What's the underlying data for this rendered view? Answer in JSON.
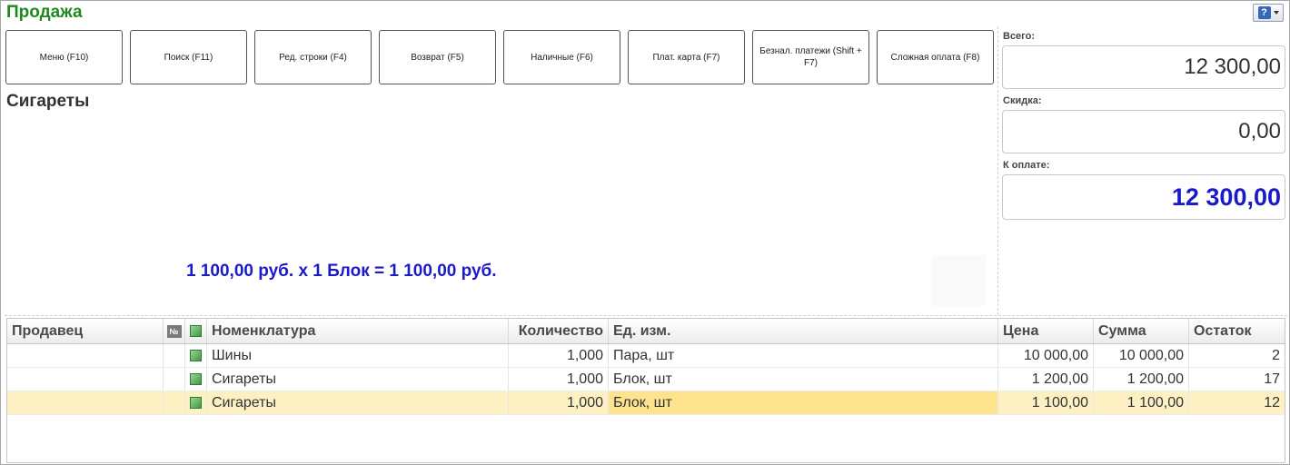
{
  "form": {
    "title": "Продажа"
  },
  "buttons": [
    {
      "label": "Меню (F10)"
    },
    {
      "label": "Поиск (F11)"
    },
    {
      "label": "Ред. строки (F4)"
    },
    {
      "label": "Возврат (F5)"
    },
    {
      "label": "Наличные (F6)"
    },
    {
      "label": "Плат. карта (F7)"
    },
    {
      "label": "Безнал. платежи (Shift + F7)"
    },
    {
      "label": "Сложная оплата (F8)"
    }
  ],
  "current_item": {
    "name": "Сигареты",
    "calculation": "1 100,00 руб. х 1 Блок = 1 100,00 руб."
  },
  "totals": {
    "total_label": "Всего:",
    "total_value": "12 300,00",
    "discount_label": "Скидка:",
    "discount_value": "0,00",
    "to_pay_label": "К оплате:",
    "to_pay_value": "12 300,00"
  },
  "table": {
    "headers": {
      "seller": "Продавец",
      "number_icon": "№",
      "nomenclature": "Номенклатура",
      "quantity": "Количество",
      "unit": "Ед. изм.",
      "price": "Цена",
      "sum": "Сумма",
      "stock": "Остаток"
    },
    "rows": [
      {
        "seller": "",
        "name": "Шины",
        "quantity": "1,000",
        "unit": "Пара, шт",
        "price": "10 000,00",
        "sum": "10 000,00",
        "stock": "2"
      },
      {
        "seller": "",
        "name": "Сигареты",
        "quantity": "1,000",
        "unit": "Блок, шт",
        "price": "1 200,00",
        "sum": "1 200,00",
        "stock": "17"
      },
      {
        "seller": "",
        "name": "Сигареты",
        "quantity": "1,000",
        "unit": "Блок, шт",
        "price": "1 100,00",
        "sum": "1 100,00",
        "stock": "12"
      }
    ],
    "selected_row": 2
  },
  "colors": {
    "title": "#1e8a1e",
    "accent_blue": "#1a1ac8",
    "selected_row": "#fdf1c4",
    "selected_cell": "#fde38e"
  },
  "icons": {
    "help": "help-question-icon",
    "row_item": "nomenclature-item-icon"
  }
}
